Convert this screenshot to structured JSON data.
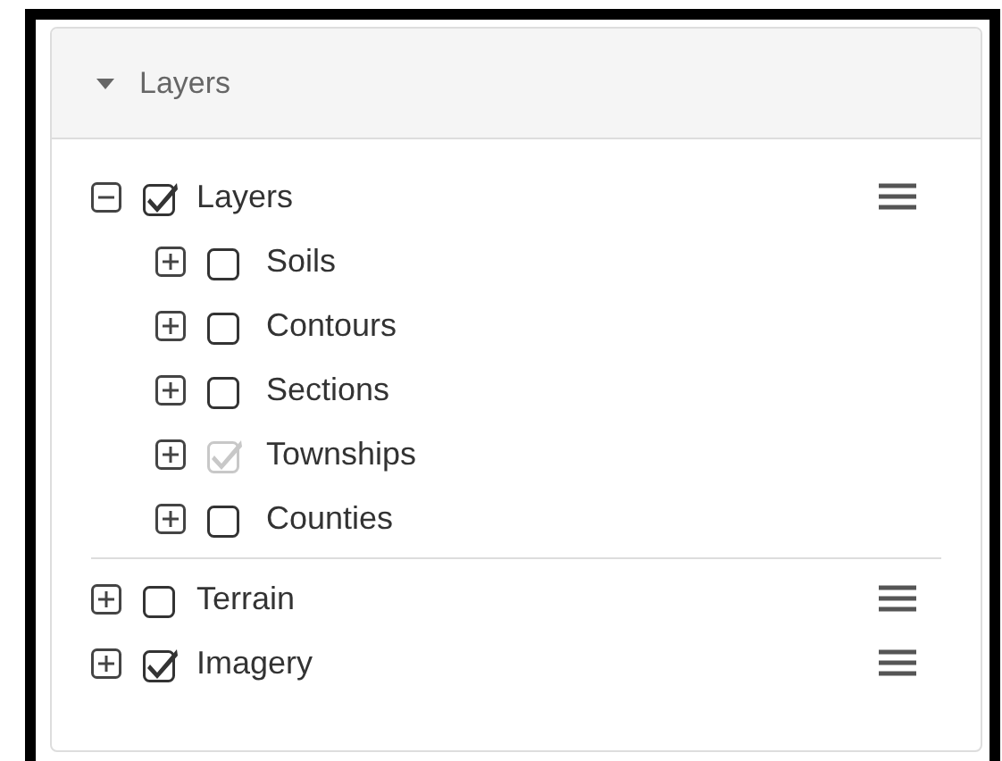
{
  "panel": {
    "title": "Layers",
    "expanded": true
  },
  "layers": [
    {
      "label": "Layers",
      "expanded": true,
      "checked": true,
      "disabled": false,
      "children": [
        {
          "label": "Soils",
          "expanded": false,
          "checked": false,
          "disabled": false
        },
        {
          "label": "Contours",
          "expanded": false,
          "checked": false,
          "disabled": false
        },
        {
          "label": "Sections",
          "expanded": false,
          "checked": false,
          "disabled": false
        },
        {
          "label": "Townships",
          "expanded": false,
          "checked": true,
          "disabled": true
        },
        {
          "label": "Counties",
          "expanded": false,
          "checked": false,
          "disabled": false
        }
      ]
    },
    {
      "label": "Terrain",
      "expanded": false,
      "checked": false,
      "disabled": false
    },
    {
      "label": "Imagery",
      "expanded": false,
      "checked": true,
      "disabled": false
    }
  ]
}
